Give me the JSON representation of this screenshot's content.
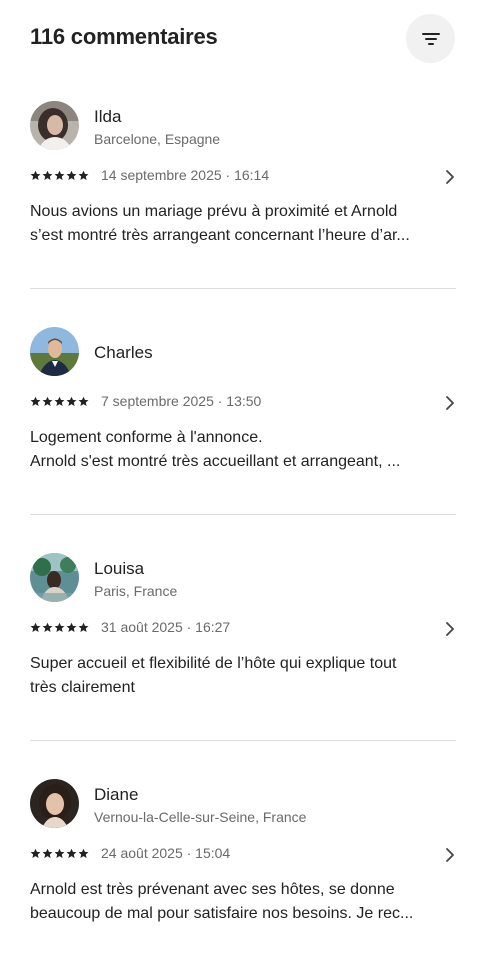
{
  "header": {
    "title": "116 commentaires",
    "filter_icon": "filter-icon"
  },
  "reviews": [
    {
      "name": "Ilda",
      "location": "Barcelone, Espagne",
      "rating": 5,
      "date": "14 septembre 2025 · 16:14",
      "text_lines": [
        "Nous avions un mariage prévu à proximité et Arnold",
        "s’est montré très arrangeant concernant l’heure d’ar..."
      ]
    },
    {
      "name": "Charles",
      "location": "",
      "rating": 5,
      "date": "7 septembre 2025 · 13:50",
      "text_lines": [
        "Logement conforme à l'annonce.",
        "Arnold s'est montré très accueillant et arrangeant, ..."
      ]
    },
    {
      "name": "Louisa",
      "location": "Paris, France",
      "rating": 5,
      "date": "31 août 2025 · 16:27",
      "text_lines": [
        "Super accueil et flexibilité de l’hôte qui explique tout",
        "très clairement"
      ]
    },
    {
      "name": "Diane",
      "location": "Vernou-la-Celle-sur-Seine, France",
      "rating": 5,
      "date": "24 août 2025 · 15:04",
      "text_lines": [
        "Arnold est très prévenant avec ses hôtes, se donne",
        "beaucoup de mal pour satisfaire nos besoins. Je rec..."
      ]
    }
  ]
}
